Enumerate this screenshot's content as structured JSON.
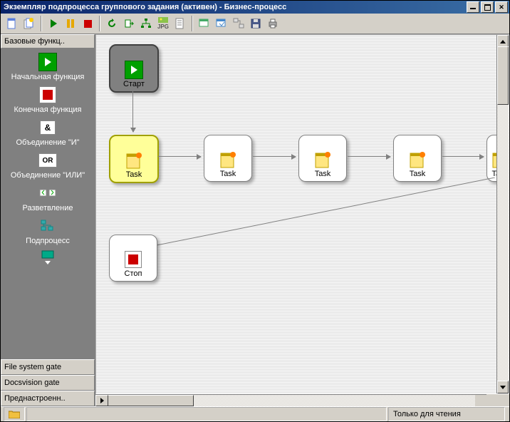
{
  "window": {
    "title": "Экземпляр подпроцесса группового задания  (активен) - Бизнес-процесс"
  },
  "sidebar": {
    "header": "Базовые функц..",
    "items": [
      {
        "label": "Начальная функция"
      },
      {
        "label": "Конечная функция"
      },
      {
        "label": "Объединение \"И\""
      },
      {
        "label": "Объединение \"ИЛИ\""
      },
      {
        "label": "Разветвление"
      },
      {
        "label": "Подпроцесс"
      }
    ],
    "buttons": [
      "File system gate",
      "Docsvision gate",
      "Преднастроенн.."
    ]
  },
  "nodes": {
    "start": "Старт",
    "task1": "Task",
    "task2": "Task",
    "task3": "Task",
    "task4": "Task",
    "task5": "Tas",
    "stop": "Стоп"
  },
  "status": {
    "readonly": "Только для чтения"
  },
  "icons": {
    "jpg_label": "JPG"
  }
}
